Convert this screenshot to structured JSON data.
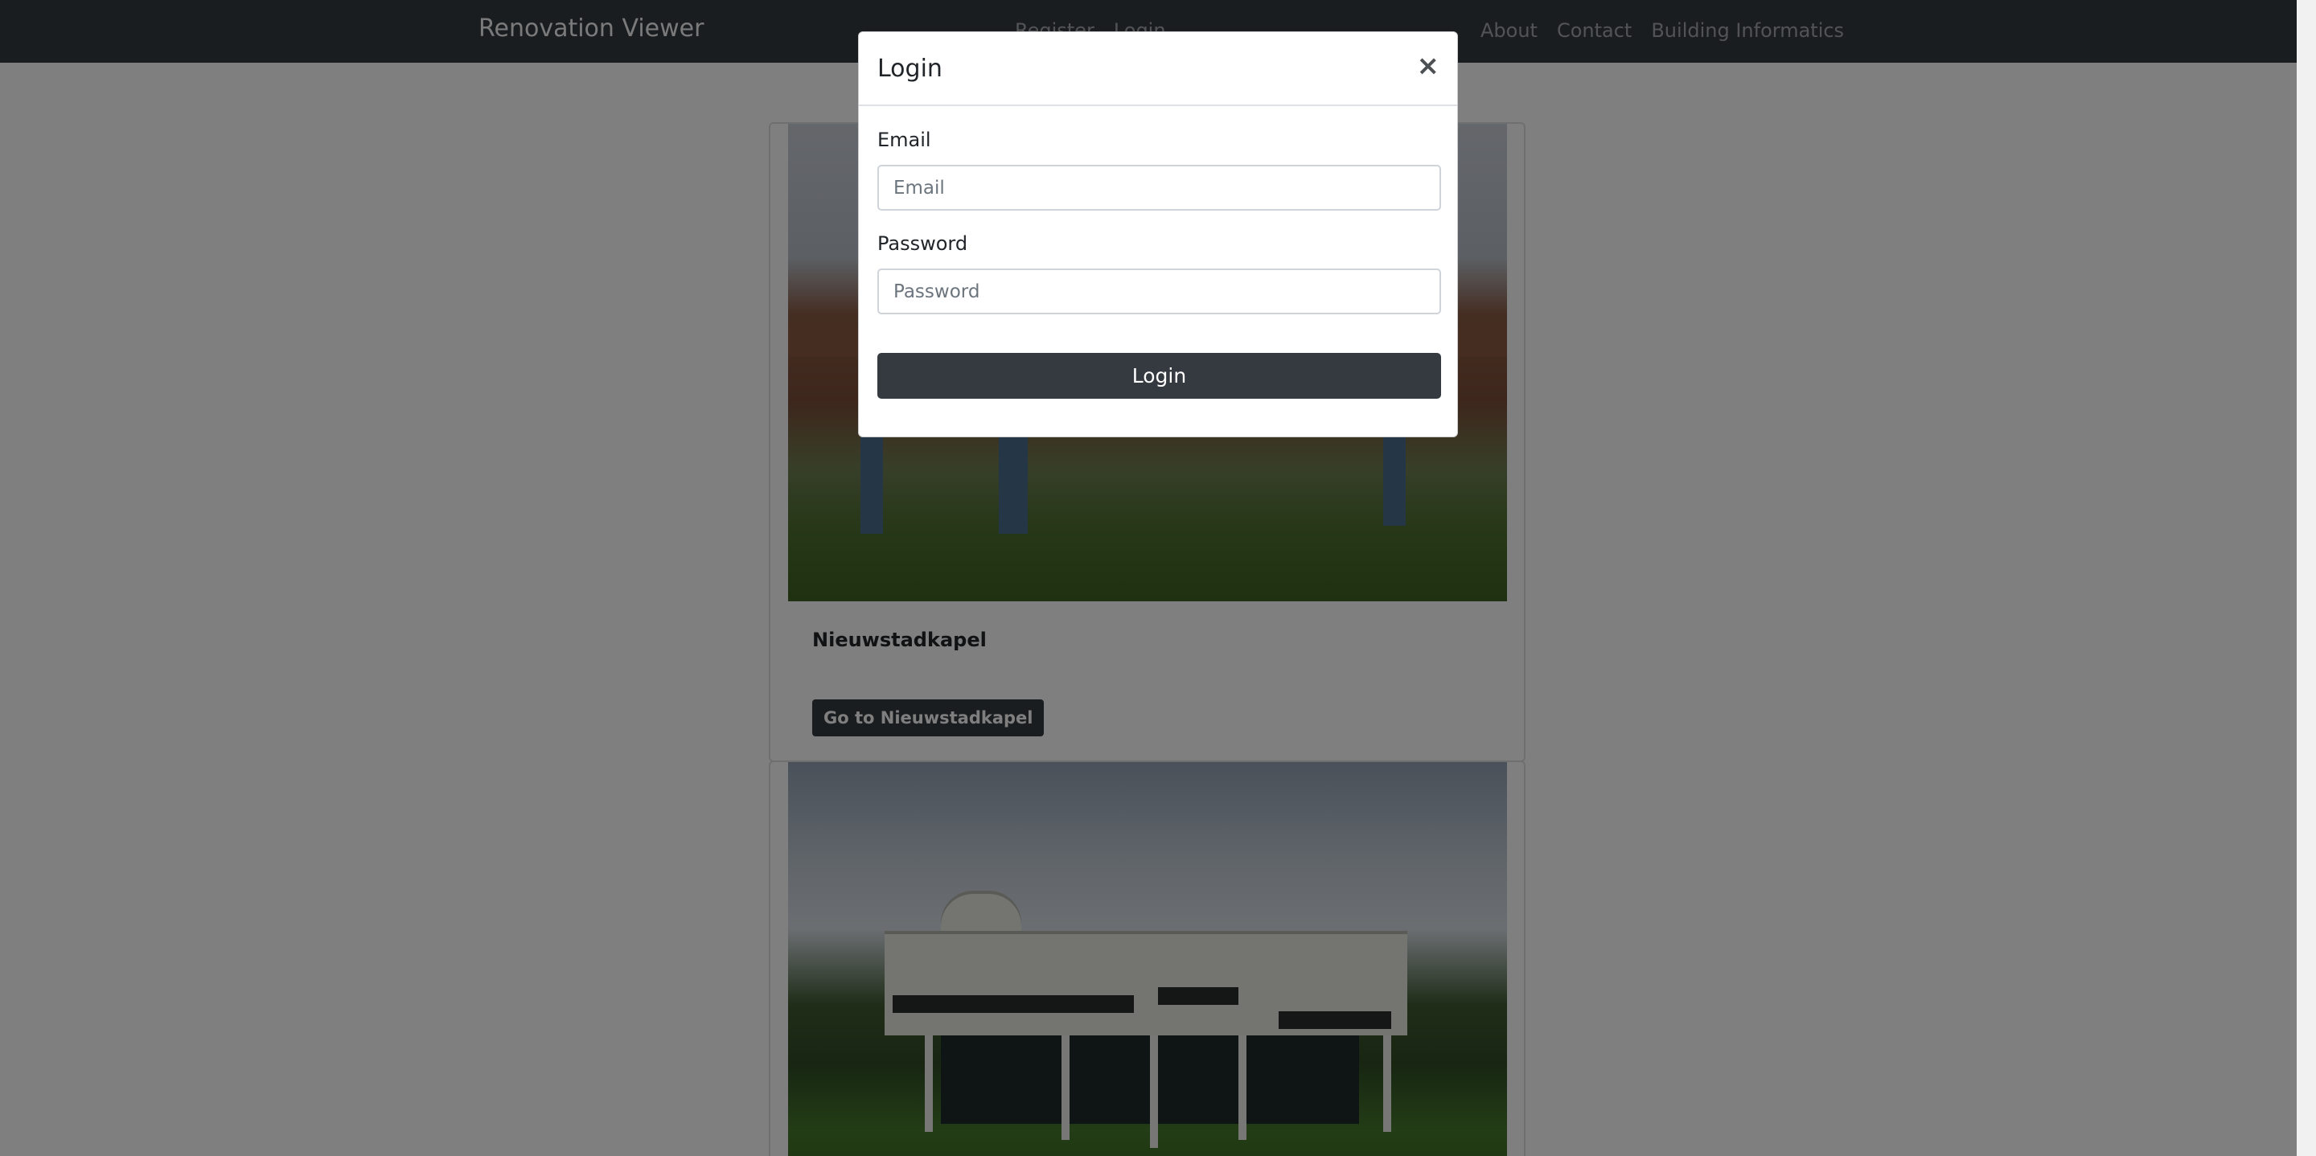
{
  "navbar": {
    "brand": "Renovation Viewer",
    "left_links": [
      "Register",
      "Login"
    ],
    "right_links": [
      "About",
      "Contact",
      "Building Informatics"
    ]
  },
  "cards": [
    {
      "title": "Nieuwstadkapel",
      "button_label": "Go to Nieuwstadkapel"
    }
  ],
  "modal": {
    "title": "Login",
    "close_glyph": "×",
    "email_label": "Email",
    "email_placeholder": "Email",
    "password_label": "Password",
    "password_placeholder": "Password",
    "submit_label": "Login"
  },
  "colors": {
    "navbar_bg": "#343a40",
    "button_bg": "#343a40",
    "backdrop": "rgba(0,0,0,0.5)"
  }
}
